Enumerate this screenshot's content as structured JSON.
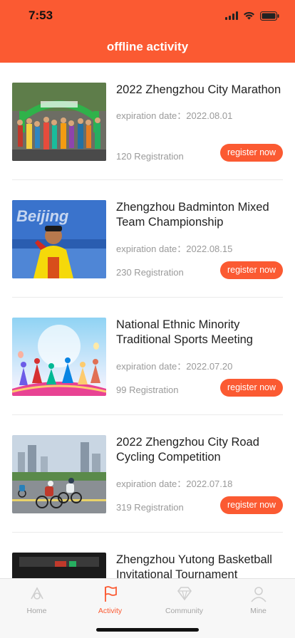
{
  "status": {
    "time": "7:53"
  },
  "header": {
    "title": "offline activity"
  },
  "activities": [
    {
      "title": "2022 Zhengzhou City Marathon",
      "expiration_label": "expiration date：",
      "date": "2022.08.01",
      "expiration_text": "expiration date：2022.08.01",
      "registration": "120 Registration",
      "button": "register now",
      "image_icon": "marathon-photo"
    },
    {
      "title": "Zhengzhou Badminton Mixed Team Championship",
      "expiration_label": "expiration date：",
      "date": "2022.08.15",
      "expiration_text": "expiration date：2022.08.15",
      "registration": "230 Registration",
      "button": "register now",
      "image_icon": "badminton-photo"
    },
    {
      "title": "National Ethnic Minority Traditional Sports Meeting",
      "expiration_label": "expiration date：",
      "date": "2022.07.20",
      "expiration_text": "expiration date：2022.07.20",
      "registration": "99 Registration",
      "button": "register now",
      "image_icon": "sports-silhouettes-photo"
    },
    {
      "title": "2022 Zhengzhou City Road Cycling Competition",
      "expiration_label": "expiration date：",
      "date": "2022.07.18",
      "expiration_text": "expiration date：2022.07.18",
      "registration": "319 Registration",
      "button": "register now",
      "image_icon": "cycling-photo"
    },
    {
      "title": "Zhengzhou Yutong Basketball Invitational Tournament",
      "image_icon": "basketball-photo"
    }
  ],
  "tabbar": {
    "active": "Activity",
    "items": [
      {
        "label": "Home",
        "icon": "home-icon"
      },
      {
        "label": "Activity",
        "icon": "flag-icon"
      },
      {
        "label": "Community",
        "icon": "diamond-icon"
      },
      {
        "label": "Mine",
        "icon": "person-icon"
      }
    ]
  },
  "colors": {
    "accent": "#fb5a32",
    "muted_text": "#9a9a9a",
    "tab_inactive": "#a5a5a5"
  }
}
